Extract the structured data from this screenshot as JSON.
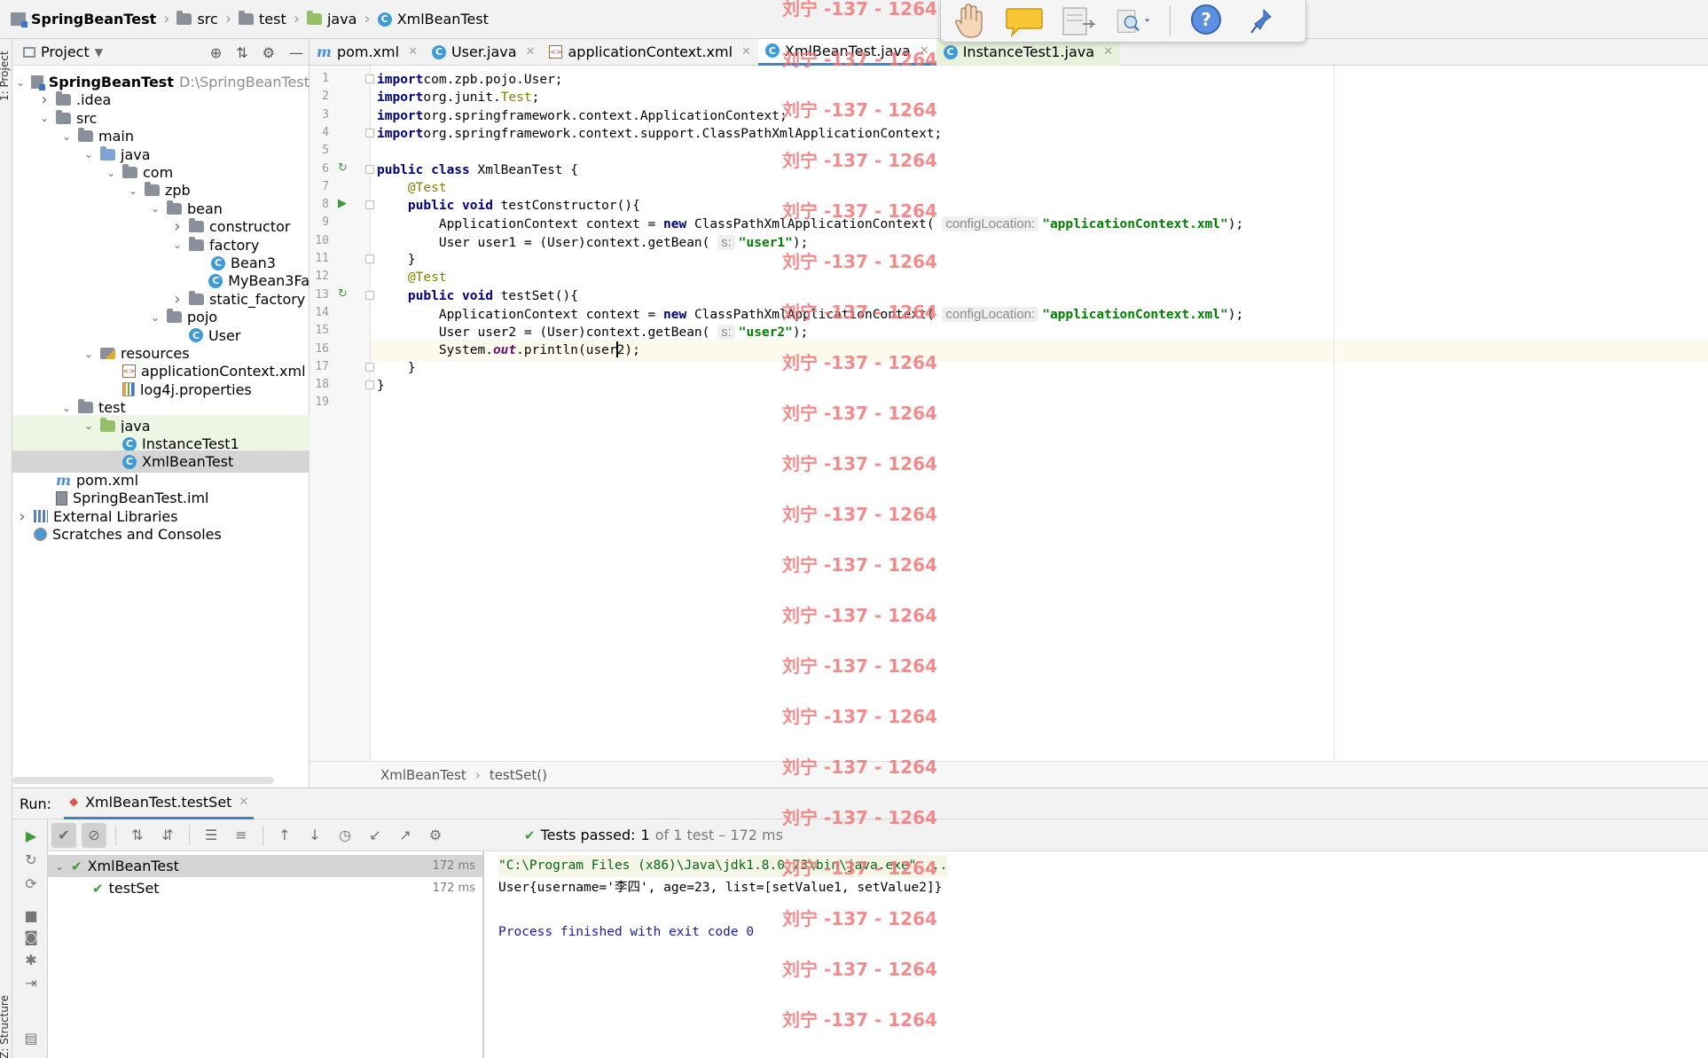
{
  "breadcrumb": [
    {
      "label": "SpringBeanTest",
      "icon": "module-icon"
    },
    {
      "label": "src",
      "icon": "folder-icon"
    },
    {
      "label": "test",
      "icon": "folder-icon"
    },
    {
      "label": "java",
      "icon": "test-folder-icon"
    },
    {
      "label": "XmlBeanTest",
      "icon": "class-icon"
    }
  ],
  "project_panel": {
    "title": "Project",
    "tree": [
      {
        "label": "SpringBeanTest",
        "sub": "D:\\SpringBeanTest",
        "depth": 0,
        "arrow": "down",
        "icon": "module",
        "bold": true
      },
      {
        "label": ".idea",
        "depth": 1,
        "arrow": "right",
        "icon": "folder"
      },
      {
        "label": "src",
        "depth": 1,
        "arrow": "down",
        "icon": "folder"
      },
      {
        "label": "main",
        "depth": 2,
        "arrow": "down",
        "icon": "folder"
      },
      {
        "label": "java",
        "depth": 3,
        "arrow": "down",
        "icon": "folder-blue"
      },
      {
        "label": "com",
        "depth": 4,
        "arrow": "down",
        "icon": "folder"
      },
      {
        "label": "zpb",
        "depth": 5,
        "arrow": "down",
        "icon": "folder"
      },
      {
        "label": "bean",
        "depth": 6,
        "arrow": "down",
        "icon": "folder"
      },
      {
        "label": "constructor",
        "depth": 7,
        "arrow": "right",
        "icon": "folder"
      },
      {
        "label": "factory",
        "depth": 7,
        "arrow": "down",
        "icon": "folder"
      },
      {
        "label": "Bean3",
        "depth": 8,
        "arrow": "",
        "icon": "class"
      },
      {
        "label": "MyBean3Fa",
        "depth": 8,
        "arrow": "",
        "icon": "class"
      },
      {
        "label": "static_factory",
        "depth": 7,
        "arrow": "right",
        "icon": "folder"
      },
      {
        "label": "pojo",
        "depth": 6,
        "arrow": "down",
        "icon": "folder"
      },
      {
        "label": "User",
        "depth": 7,
        "arrow": "",
        "icon": "class"
      },
      {
        "label": "resources",
        "depth": 3,
        "arrow": "down",
        "icon": "folder-res"
      },
      {
        "label": "applicationContext.xml",
        "depth": 4,
        "arrow": "",
        "icon": "xml"
      },
      {
        "label": "log4j.properties",
        "depth": 4,
        "arrow": "",
        "icon": "props"
      },
      {
        "label": "test",
        "depth": 2,
        "arrow": "down",
        "icon": "folder"
      },
      {
        "label": "java",
        "depth": 3,
        "arrow": "down",
        "icon": "folder-green",
        "highlight": "test"
      },
      {
        "label": "InstanceTest1",
        "depth": 4,
        "arrow": "",
        "icon": "class",
        "highlight": "test"
      },
      {
        "label": "XmlBeanTest",
        "depth": 4,
        "arrow": "",
        "icon": "class",
        "highlight": "selected"
      },
      {
        "label": "pom.xml",
        "depth": 1,
        "arrow": "",
        "icon": "maven"
      },
      {
        "label": "SpringBeanTest.iml",
        "depth": 1,
        "arrow": "",
        "icon": "iml"
      },
      {
        "label": "External Libraries",
        "depth": 0,
        "arrow": "right",
        "icon": "libs"
      },
      {
        "label": "Scratches and Consoles",
        "depth": 0,
        "arrow": "",
        "icon": "scratch"
      }
    ]
  },
  "tabs": [
    {
      "label": "pom.xml",
      "icon": "maven",
      "state": "normal"
    },
    {
      "label": "User.java",
      "icon": "class",
      "state": "normal"
    },
    {
      "label": "applicationContext.xml",
      "icon": "xml",
      "state": "normal"
    },
    {
      "label": "XmlBeanTest.java",
      "icon": "class",
      "state": "active"
    },
    {
      "label": "InstanceTest1.java",
      "icon": "class",
      "state": "test"
    }
  ],
  "editor": {
    "current_line": 16,
    "lines": [
      {
        "n": "1",
        "tokens": [
          [
            "kw",
            "import"
          ],
          [
            "",
            "com.zpb.pojo.User;"
          ]
        ]
      },
      {
        "n": "2",
        "tokens": [
          [
            "kw",
            "import"
          ],
          [
            "",
            "org.junit."
          ],
          [
            "ann",
            "Test"
          ],
          [
            "",
            ";"
          ]
        ]
      },
      {
        "n": "3",
        "tokens": [
          [
            "kw",
            "import"
          ],
          [
            "",
            "org.springframework.context.ApplicationContext;"
          ]
        ]
      },
      {
        "n": "4",
        "tokens": [
          [
            "kw",
            "import"
          ],
          [
            "",
            "org.springframework.context.support.ClassPathXmlApplicationContext;"
          ]
        ]
      },
      {
        "n": "5",
        "tokens": []
      },
      {
        "n": "6",
        "tokens": [
          [
            "kw",
            "public class"
          ],
          [
            "",
            " XmlBeanTest {"
          ]
        ]
      },
      {
        "n": "7",
        "tokens": [
          [
            "",
            "    "
          ],
          [
            "ann",
            "@Test"
          ]
        ]
      },
      {
        "n": "8",
        "tokens": [
          [
            "",
            "    "
          ],
          [
            "kw",
            "public void"
          ],
          [
            "",
            " testConstructor(){"
          ]
        ]
      },
      {
        "n": "9",
        "tokens": [
          [
            "",
            "        ApplicationContext context = "
          ],
          [
            "kw",
            "new"
          ],
          [
            "",
            " ClassPathXmlApplicationContext( "
          ],
          [
            "hint",
            "configLocation:"
          ],
          [
            "str",
            "\"applicationContext.xml\""
          ],
          [
            "",
            ");"
          ]
        ]
      },
      {
        "n": "10",
        "tokens": [
          [
            "",
            "        User user1 = (User)context.getBean( "
          ],
          [
            "hint",
            "s:"
          ],
          [
            "str",
            "\"user1\""
          ],
          [
            "",
            ");"
          ]
        ]
      },
      {
        "n": "11",
        "tokens": [
          [
            "",
            "    }"
          ]
        ]
      },
      {
        "n": "12",
        "tokens": [
          [
            "",
            "    "
          ],
          [
            "ann",
            "@Test"
          ]
        ]
      },
      {
        "n": "13",
        "tokens": [
          [
            "",
            "    "
          ],
          [
            "kw",
            "public void"
          ],
          [
            "",
            " testSet(){"
          ]
        ]
      },
      {
        "n": "14",
        "tokens": [
          [
            "",
            "        ApplicationContext context = "
          ],
          [
            "kw",
            "new"
          ],
          [
            "",
            " ClassPathXmlApplicationContext( "
          ],
          [
            "hint",
            "configLocation:"
          ],
          [
            "str",
            "\"applicationContext.xml\""
          ],
          [
            "",
            ");"
          ]
        ]
      },
      {
        "n": "15",
        "tokens": [
          [
            "",
            "        User user2 = (User)context.getBean( "
          ],
          [
            "hint",
            "s:"
          ],
          [
            "str",
            "\"user2\""
          ],
          [
            "",
            ");"
          ]
        ]
      },
      {
        "n": "16",
        "tokens": [
          [
            "",
            "        System."
          ],
          [
            "stat",
            "out"
          ],
          [
            "",
            ".println(user2);"
          ]
        ]
      },
      {
        "n": "17",
        "tokens": [
          [
            "",
            "    }"
          ]
        ]
      },
      {
        "n": "18",
        "tokens": [
          [
            "",
            "}"
          ]
        ]
      },
      {
        "n": "19",
        "tokens": []
      }
    ]
  },
  "editor_breadcrumb": [
    "XmlBeanTest",
    "testSet()"
  ],
  "run": {
    "label": "Run:",
    "tab": "XmlBeanTest.testSet",
    "status_prefix": "Tests passed:",
    "status_count": "1",
    "status_detail": "of 1 test – 172 ms",
    "tests": [
      {
        "name": "XmlBeanTest",
        "time": "172 ms",
        "depth": 0
      },
      {
        "name": "testSet",
        "time": "172 ms",
        "depth": 1
      }
    ],
    "console": [
      {
        "text": "\"C:\\Program Files (x86)\\Java\\jdk1.8.0_73\\bin\\java.exe\" ...",
        "kind": "cmd"
      },
      {
        "text": "User{username='李四', age=23, list=[setValue1, setValue2]}",
        "kind": "out"
      },
      {
        "text": "",
        "kind": "out"
      },
      {
        "text": "Process finished with exit code 0",
        "kind": "exit"
      }
    ]
  },
  "side_tabs": {
    "project": "1: Project",
    "structure": "Z: Structure"
  },
  "watermark": "刘宁 -137 - 1264",
  "colors": {
    "accent": "#4083c9",
    "keyword": "#000080",
    "string": "#008000",
    "annotation": "#808000",
    "watermark": "#f07878",
    "pass": "#3c9a3c"
  }
}
